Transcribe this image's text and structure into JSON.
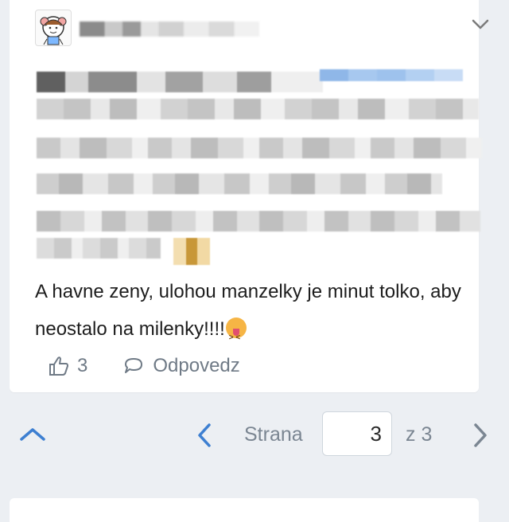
{
  "post": {
    "visible_text": "A havne zeny, ulohou manzelky je minut tolko, aby neostalo na milenky!!!!",
    "like_count": "3",
    "reply_label": "Odpovedz"
  },
  "pagination": {
    "page_label": "Strana",
    "current_page": "3",
    "total_label": "z 3"
  },
  "colors": {
    "accent": "#3d7fd1",
    "muted_text": "#6f7a86",
    "background": "#eceff3",
    "card": "#ffffff"
  },
  "icons": {
    "collapse": "chevron-down-icon",
    "like": "thumbs-up-icon",
    "reply": "speech-bubble-icon",
    "scroll_top": "chevron-up-icon",
    "prev": "chevron-left-icon",
    "next": "chevron-right-icon",
    "emoji": "tongue-out-emoji-icon"
  }
}
